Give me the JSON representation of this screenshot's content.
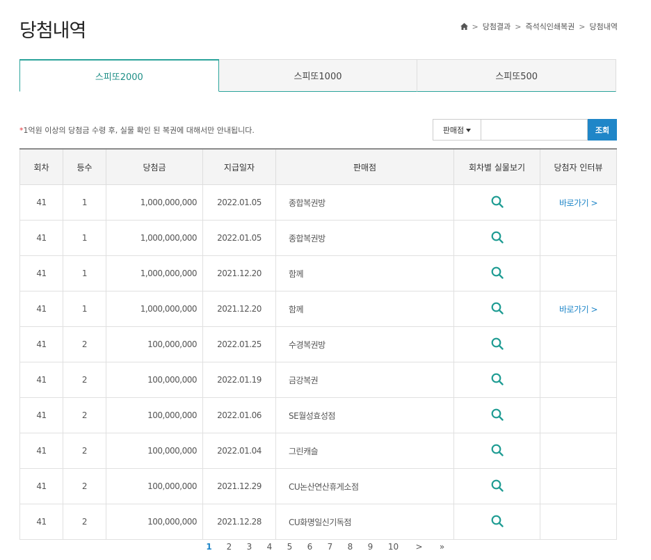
{
  "page": {
    "title": "당첨내역"
  },
  "breadcrumb": {
    "items": [
      "당첨결과",
      "즉석식인쇄복권",
      "당첨내역"
    ]
  },
  "tabs": [
    {
      "label": "스피또2000",
      "active": true
    },
    {
      "label": "스피또1000",
      "active": false
    },
    {
      "label": "스피또500",
      "active": false
    }
  ],
  "notice": {
    "star": "*",
    "text": "1억원 이상의 당첨금 수령 후, 실물 확인 된 복권에 대해서만 안내됩니다."
  },
  "search": {
    "select_label": "판매점",
    "input_value": "",
    "button_label": "조회"
  },
  "table": {
    "headers": [
      "회차",
      "등수",
      "당첨금",
      "지급일자",
      "판매점",
      "회차별 실물보기",
      "당첨자 인터뷰"
    ],
    "rows": [
      {
        "round": "41",
        "rank": "1",
        "amount": "1,000,000,000",
        "date": "2022.01.05",
        "shop": "종합복권방",
        "interview": "바로가기 >"
      },
      {
        "round": "41",
        "rank": "1",
        "amount": "1,000,000,000",
        "date": "2022.01.05",
        "shop": "종합복권방",
        "interview": ""
      },
      {
        "round": "41",
        "rank": "1",
        "amount": "1,000,000,000",
        "date": "2021.12.20",
        "shop": "함께",
        "interview": ""
      },
      {
        "round": "41",
        "rank": "1",
        "amount": "1,000,000,000",
        "date": "2021.12.20",
        "shop": "함께",
        "interview": "바로가기 >"
      },
      {
        "round": "41",
        "rank": "2",
        "amount": "100,000,000",
        "date": "2022.01.25",
        "shop": "수경복권방",
        "interview": ""
      },
      {
        "round": "41",
        "rank": "2",
        "amount": "100,000,000",
        "date": "2022.01.19",
        "shop": "금강복권",
        "interview": ""
      },
      {
        "round": "41",
        "rank": "2",
        "amount": "100,000,000",
        "date": "2022.01.06",
        "shop": "SE월성효성점",
        "interview": ""
      },
      {
        "round": "41",
        "rank": "2",
        "amount": "100,000,000",
        "date": "2022.01.04",
        "shop": "그린캐슬",
        "interview": ""
      },
      {
        "round": "41",
        "rank": "2",
        "amount": "100,000,000",
        "date": "2021.12.29",
        "shop": "CU논산연산휴게소점",
        "interview": ""
      },
      {
        "round": "41",
        "rank": "2",
        "amount": "100,000,000",
        "date": "2021.12.28",
        "shop": "CU화명일신기독점",
        "interview": ""
      }
    ]
  },
  "pagination": {
    "pages": [
      "1",
      "2",
      "3",
      "4",
      "5",
      "6",
      "7",
      "8",
      "9",
      "10"
    ],
    "current": "1",
    "next": ">",
    "last": "»"
  },
  "colors": {
    "accent": "#2aa39a",
    "blue": "#1f86c8",
    "notice_star": "#e5343a"
  }
}
